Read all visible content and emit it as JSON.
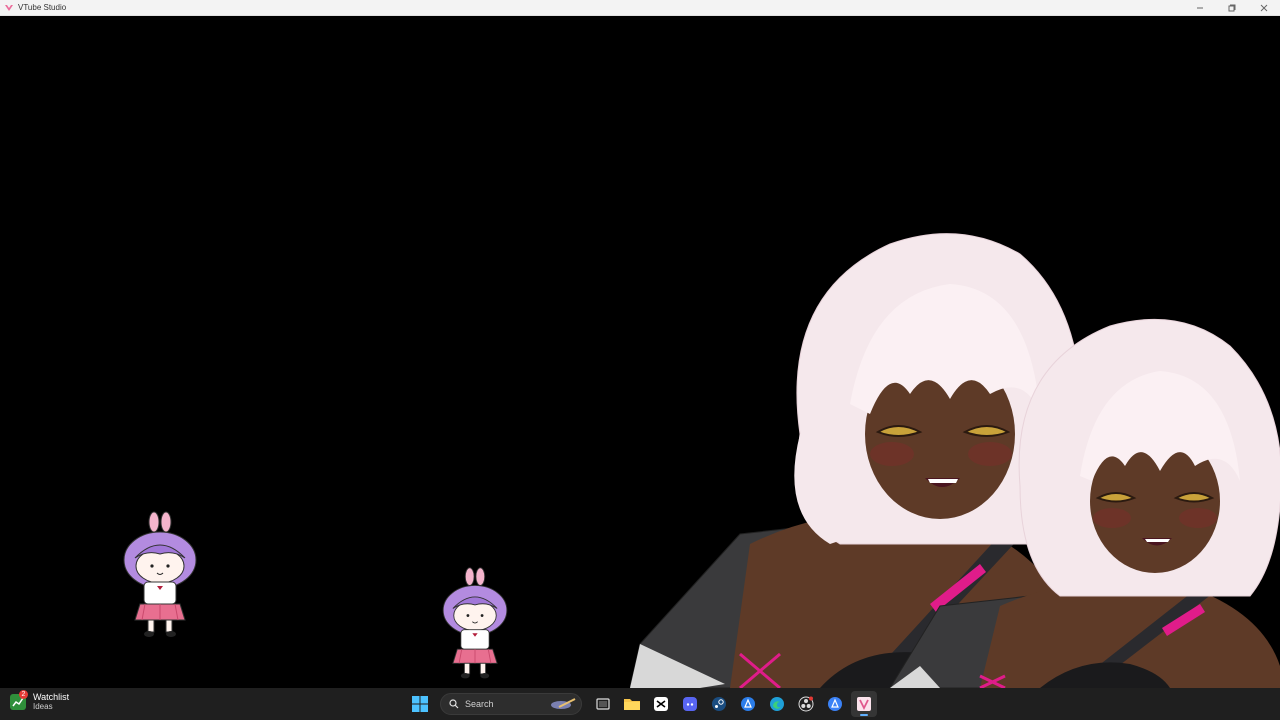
{
  "window": {
    "title": "VTube Studio",
    "controls": {
      "minimize_icon": "minimize-icon",
      "maximize_icon": "restore-icon",
      "close_icon": "close-icon"
    }
  },
  "colors": {
    "stage_background": "#000000",
    "taskbar_background": "#1f1f1f",
    "hair": "#f8e4ea",
    "skin": "#5b3724",
    "chibi_hair": "#b38be0",
    "chibi_bow": "#f2a6c4",
    "accent_pink": "#e01c8a"
  },
  "taskbar": {
    "widget": {
      "title": "Watchlist",
      "subtitle": "Ideas",
      "badge": "2"
    },
    "search_label": "Search",
    "apps": [
      "windows-start-icon",
      "search-icon",
      "task-view-icon",
      "file-explorer-icon",
      "capcut-icon",
      "discord-icon",
      "steam-icon",
      "bluestacks-icon",
      "edge-icon",
      "obs-icon",
      "bluestacks-x-icon",
      "vtube-studio-icon"
    ]
  }
}
